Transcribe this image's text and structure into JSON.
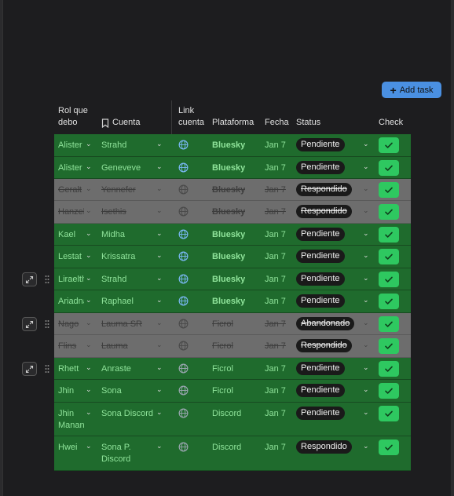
{
  "toolbar": {
    "add_task_label": "Add task"
  },
  "columns": {
    "rol": "Rol que debo",
    "cuenta": "Cuenta",
    "link": "Link cuenta",
    "plataforma": "Plataforma",
    "fecha": "Fecha",
    "status": "Status",
    "check": "Check"
  },
  "rows": [
    {
      "rol": "Alister",
      "cuenta": "Strahd",
      "plataforma": "Bluesky",
      "fecha": "Jan 7",
      "status": "Pendiente",
      "done": false
    },
    {
      "rol": "Alister",
      "cuenta": "Geneveve",
      "plataforma": "Bluesky",
      "fecha": "Jan 7",
      "status": "Pendiente",
      "done": false
    },
    {
      "rol": "Geralt",
      "cuenta": "Yennefer",
      "plataforma": "Bluesky",
      "fecha": "Jan 7",
      "status": "Respondido",
      "done": true
    },
    {
      "rol": "Hanzel",
      "cuenta": "Isethis",
      "plataforma": "Bluesky",
      "fecha": "Jan 7",
      "status": "Respondido",
      "done": true
    },
    {
      "rol": "Kael",
      "cuenta": "Midha",
      "plataforma": "Bluesky",
      "fecha": "Jan 7",
      "status": "Pendiente",
      "done": false
    },
    {
      "rol": "Lestat",
      "cuenta": "Krissatra",
      "plataforma": "Bluesky",
      "fecha": "Jan 7",
      "status": "Pendiente",
      "done": false
    },
    {
      "rol": "Liraelth",
      "cuenta": "Strahd",
      "plataforma": "Bluesky",
      "fecha": "Jan 7",
      "status": "Pendiente",
      "done": false
    },
    {
      "rol": "Ariadna",
      "cuenta": "Raphael",
      "plataforma": "Bluesky",
      "fecha": "Jan 7",
      "status": "Pendiente",
      "done": false
    },
    {
      "rol": "Nago",
      "cuenta": "Lauma SR",
      "plataforma": "Ficrol",
      "fecha": "Jan 7",
      "status": "Abandonado",
      "done": true
    },
    {
      "rol": "Flins",
      "cuenta": "Lauma",
      "plataforma": "Ficrol",
      "fecha": "Jan 7",
      "status": "Respondido",
      "done": true
    },
    {
      "rol": "Rhett",
      "cuenta": "Anraste",
      "plataforma": "Ficrol",
      "fecha": "Jan 7",
      "status": "Pendiente",
      "done": false
    },
    {
      "rol": "Jhin",
      "cuenta": "Sona",
      "plataforma": "Ficrol",
      "fecha": "Jan 7",
      "status": "Pendiente",
      "done": false
    },
    {
      "rol": "Jhin\nManan",
      "cuenta": "Sona Discord",
      "plataforma": "Discord",
      "fecha": "Jan 7",
      "status": "Pendiente",
      "done": false
    },
    {
      "rol": "Hwei",
      "cuenta": "Sona P.\nDiscord",
      "plataforma": "Discord",
      "fecha": "Jan 7",
      "status": "Respondido",
      "done": false
    }
  ],
  "colors": {
    "row_pending_bg": "#1f6b2d",
    "row_done_bg": "#6d6d6d",
    "text_pending": "#8fe39a",
    "check_green": "#2ec860",
    "accent_blue": "#4a90e2"
  },
  "icons": {
    "link": "globe-icon",
    "cuenta_header": "bookmark-icon",
    "row_open": "expand-icon",
    "row_drag": "drag-handle-icon",
    "dropdown": "chevron-down-icon",
    "check": "checkmark-icon",
    "add": "plus-icon"
  }
}
